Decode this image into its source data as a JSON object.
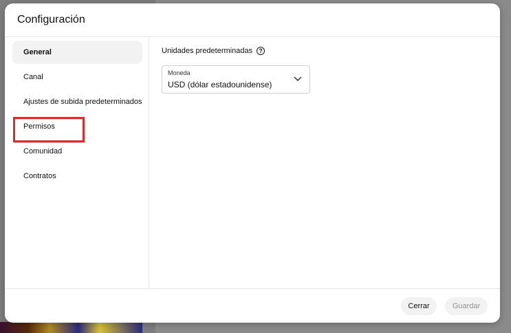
{
  "dialog": {
    "title": "Configuración"
  },
  "sidebar": {
    "items": [
      {
        "label": "General",
        "active": true
      },
      {
        "label": "Canal",
        "active": false
      },
      {
        "label": "Ajustes de subida predeterminados",
        "active": false
      },
      {
        "label": "Permisos",
        "active": false
      },
      {
        "label": "Comunidad",
        "active": false
      },
      {
        "label": "Contratos",
        "active": false
      }
    ],
    "highlighted_item": "Permisos",
    "highlight_color": "#d32f2f"
  },
  "content": {
    "section_label": "Unidades predeterminadas",
    "help_icon": "question-circle-icon",
    "currency_select": {
      "caption": "Moneda",
      "value": "USD (dólar estadounidense)",
      "icon": "chevron-down-icon"
    }
  },
  "footer": {
    "close_label": "Cerrar",
    "save_label": "Guardar",
    "save_enabled": false
  }
}
